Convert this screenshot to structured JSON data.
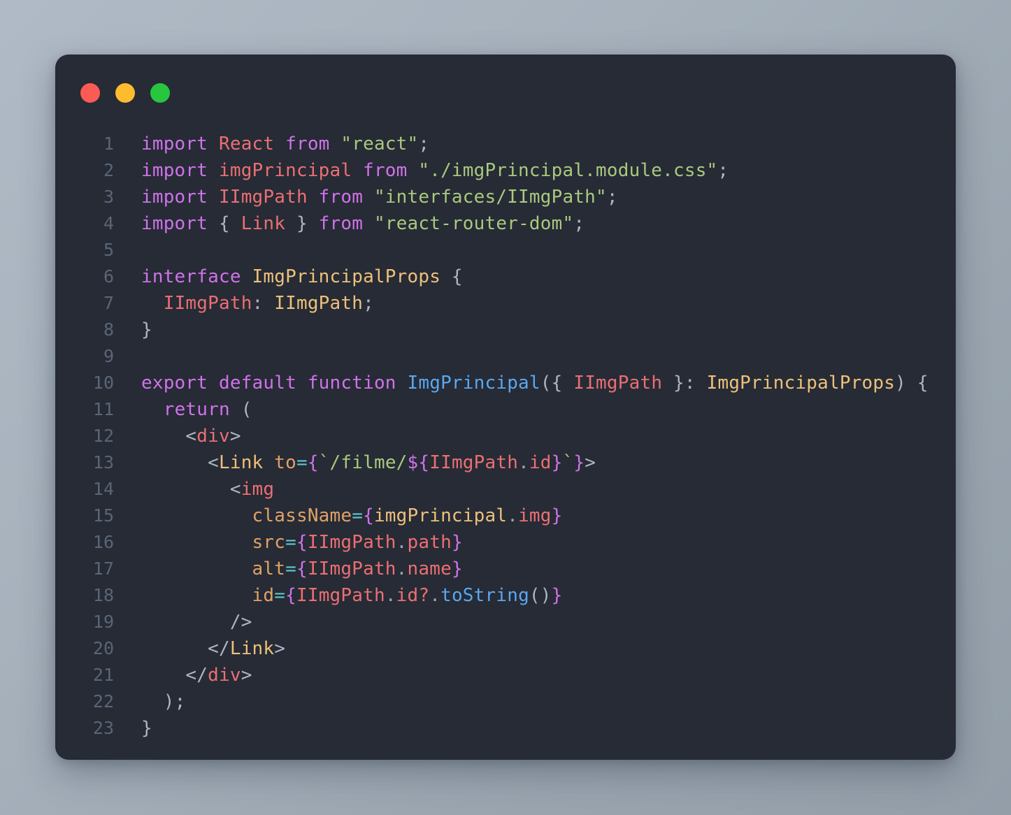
{
  "window": {
    "title_bar": {
      "buttons": [
        {
          "name": "close",
          "label": "Close",
          "color": "#fb5b55"
        },
        {
          "name": "minimize",
          "label": "Minimize",
          "color": "#fdbc2e"
        },
        {
          "name": "maximize",
          "label": "Maximize",
          "color": "#27c63e"
        }
      ]
    },
    "background_color": "#262b35",
    "page_background": "#a7b2bd"
  },
  "editor": {
    "language": "tsx",
    "line_number_color": "#5b6576",
    "default_text_color": "#c8ced9",
    "palette": {
      "keyword": "#d072ea",
      "variable": "#eb6f73",
      "string": "#a9c97e",
      "type": "#eec07b",
      "function": "#5aa7f0",
      "punctuation": "#aeb6c2",
      "attribute": "#e0a167",
      "operator": "#5fc9cf"
    },
    "line_numbers": [
      "1",
      "2",
      "3",
      "4",
      "5",
      "6",
      "7",
      "8",
      "9",
      "10",
      "11",
      "12",
      "13",
      "14",
      "15",
      "16",
      "17",
      "18",
      "19",
      "20",
      "21",
      "22",
      "23"
    ],
    "lines": [
      {
        "n": "1",
        "text": "import React from \"react\";"
      },
      {
        "n": "2",
        "text": "import imgPrincipal from \"./imgPrincipal.module.css\";"
      },
      {
        "n": "3",
        "text": "import IImgPath from \"interfaces/IImgPath\";"
      },
      {
        "n": "4",
        "text": "import { Link } from \"react-router-dom\";"
      },
      {
        "n": "5",
        "text": ""
      },
      {
        "n": "6",
        "text": "interface ImgPrincipalProps {"
      },
      {
        "n": "7",
        "text": "  IImgPath: IImgPath;"
      },
      {
        "n": "8",
        "text": "}"
      },
      {
        "n": "9",
        "text": ""
      },
      {
        "n": "10",
        "text": "export default function ImgPrincipal({ IImgPath }: ImgPrincipalProps) {"
      },
      {
        "n": "11",
        "text": "  return ("
      },
      {
        "n": "12",
        "text": "    <div>"
      },
      {
        "n": "13",
        "text": "      <Link to={`/filme/${IImgPath.id}`}>"
      },
      {
        "n": "14",
        "text": "        <img"
      },
      {
        "n": "15",
        "text": "          className={imgPrincipal.img}"
      },
      {
        "n": "16",
        "text": "          src={IImgPath.path}"
      },
      {
        "n": "17",
        "text": "          alt={IImgPath.name}"
      },
      {
        "n": "18",
        "text": "          id={IImgPath.id?.toString()}"
      },
      {
        "n": "19",
        "text": "        />"
      },
      {
        "n": "20",
        "text": "      </Link>"
      },
      {
        "n": "21",
        "text": "    </div>"
      },
      {
        "n": "22",
        "text": "  );"
      },
      {
        "n": "23",
        "text": "}"
      }
    ],
    "tokens": {
      "l1": {
        "kw1": "import",
        "var1": "React",
        "kw2": "from",
        "str1": "\"react\"",
        "p1": ";"
      },
      "l2": {
        "kw1": "import",
        "var1": "imgPrincipal",
        "kw2": "from",
        "str1": "\"./imgPrincipal.module.css\"",
        "p1": ";"
      },
      "l3": {
        "kw1": "import",
        "var1": "IImgPath",
        "kw2": "from",
        "str1": "\"interfaces/IImgPath\"",
        "p1": ";"
      },
      "l4": {
        "kw1": "import",
        "p1": "{",
        "var1": "Link",
        "p2": "}",
        "kw2": "from",
        "str1": "\"react-router-dom\"",
        "p3": ";"
      },
      "l6": {
        "kw1": "interface",
        "type1": "ImgPrincipalProps",
        "p1": "{"
      },
      "l7": {
        "var1": "IImgPath",
        "p1": ":",
        "type1": "IImgPath",
        "p2": ";"
      },
      "l8": {
        "p1": "}"
      },
      "l10": {
        "kw1": "export",
        "kw2": "default",
        "kw3": "function",
        "fn1": "ImgPrincipal",
        "p1": "({",
        "var1": "IImgPath",
        "p2": "}:",
        "type1": "ImgPrincipalProps",
        "p3": ")",
        "p4": "{"
      },
      "l11": {
        "kw1": "return",
        "p1": "("
      },
      "l12": {
        "p1": "<",
        "tag1": "div",
        "p2": ">"
      },
      "l13": {
        "p1": "<",
        "type1": "Link",
        "attr1": "to",
        "op1": "=",
        "b1": "{",
        "str1": "`/filme/",
        "b2": "${",
        "var1": "IImgPath",
        "dot1": ".",
        "prop1": "id",
        "b3": "}",
        "str2": "`",
        "b4": "}",
        "p2": ">"
      },
      "l14": {
        "p1": "<",
        "tag1": "img"
      },
      "l15": {
        "attr1": "className",
        "op1": "=",
        "b1": "{",
        "type1": "imgPrincipal",
        "dot1": ".",
        "prop1": "img",
        "b2": "}"
      },
      "l16": {
        "attr1": "src",
        "op1": "=",
        "b1": "{",
        "var1": "IImgPath",
        "dot1": ".",
        "prop1": "path",
        "b2": "}"
      },
      "l17": {
        "attr1": "alt",
        "op1": "=",
        "b1": "{",
        "var1": "IImgPath",
        "dot1": ".",
        "prop1": "name",
        "b2": "}"
      },
      "l18": {
        "attr1": "id",
        "op1": "=",
        "b1": "{",
        "var1": "IImgPath",
        "dot1": ".",
        "prop1": "id?",
        "dot2": ".",
        "fn1": "toString",
        "p1": "()",
        "b2": "}"
      },
      "l19": {
        "p1": "/>"
      },
      "l20": {
        "p1": "</",
        "type1": "Link",
        "p2": ">"
      },
      "l21": {
        "p1": "</",
        "tag1": "div",
        "p2": ">"
      },
      "l22": {
        "p1": ");"
      },
      "l23": {
        "p1": "}"
      }
    }
  }
}
